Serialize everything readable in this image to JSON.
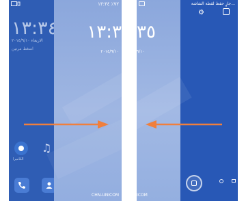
{
  "colors": {
    "home_background": "#2f5db4",
    "lock_overlay": "#93aee0",
    "arrow": "#f07f3c"
  },
  "left_panel": {
    "home_clock": "١٣:٣٤",
    "home_date": "الاربعاء ٢٠١٤/٩/١٠",
    "weather_text": "اضغط مرتين",
    "app_label": "الكاميرا",
    "lock_status": "٧٢٪ ١٣:٣٤",
    "lock_clock": "١٣:٣",
    "lock_date": "٢٠١٤/٩/١٠",
    "carrier": "CHN-UNICOM",
    "swipe_direction": "right"
  },
  "right_panel": {
    "lock_clock": "٣٥",
    "lock_date": "٩/١٠",
    "carrier": "ICOM",
    "notification_text": "جارٍ حفظ لقطة الشاشة...",
    "swipe_direction": "left"
  },
  "icons": [
    "gallery-icon",
    "camera-icon",
    "music-icon",
    "phone-icon",
    "contacts-icon",
    "settings-icon",
    "screenshot-icon"
  ]
}
